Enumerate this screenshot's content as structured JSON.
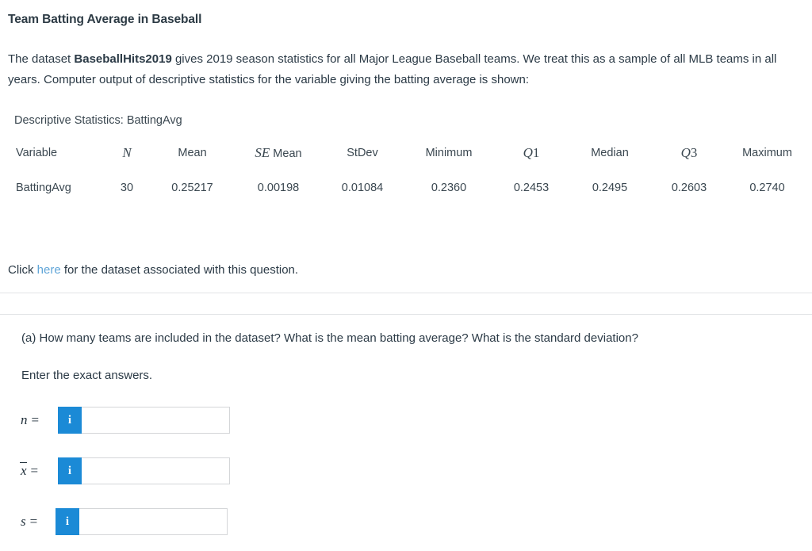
{
  "page": {
    "title": "Team Batting Average in Baseball",
    "intro_before_bold": "The dataset ",
    "intro_bold": "BaseballHits2019",
    "intro_after_bold": " gives 2019 season statistics for all Major League Baseball teams. We treat this as a sample of all MLB teams in all years. Computer output of descriptive statistics for the variable giving the batting average is shown:"
  },
  "stats_output": {
    "caption": "Descriptive Statistics: BattingAvg",
    "columns": [
      {
        "key": "variable",
        "label": "Variable",
        "style": "plain"
      },
      {
        "key": "n",
        "label": "N",
        "style": "math"
      },
      {
        "key": "mean",
        "label": "Mean",
        "style": "plain"
      },
      {
        "key": "se_mean",
        "label": "SE Mean",
        "style": "math-prefix"
      },
      {
        "key": "stdev",
        "label": "StDev",
        "style": "plain"
      },
      {
        "key": "minimum",
        "label": "Minimum",
        "style": "plain"
      },
      {
        "key": "q1",
        "label": "Q1",
        "style": "math"
      },
      {
        "key": "median",
        "label": "Median",
        "style": "plain"
      },
      {
        "key": "q3",
        "label": "Q3",
        "style": "math"
      },
      {
        "key": "maximum",
        "label": "Maximum",
        "style": "plain"
      }
    ],
    "header": {
      "variable": "Variable",
      "n": "N",
      "se_mean_italic": "SE",
      "se_mean_rest": " Mean",
      "mean": "Mean",
      "stdev": "StDev",
      "minimum": "Minimum",
      "q1_italic": "Q",
      "q1_num": "1",
      "median": "Median",
      "q3_italic": "Q",
      "q3_num": "3",
      "maximum": "Maximum"
    },
    "row": {
      "variable": "BattingAvg",
      "n": "30",
      "mean": "0.25217",
      "se_mean": "0.00198",
      "stdev": "0.01084",
      "minimum": "0.2360",
      "q1": "0.2453",
      "median": "0.2495",
      "q3": "0.2603",
      "maximum": "0.2740"
    }
  },
  "dataset_link": {
    "text_before": "Click ",
    "link_label": "here",
    "text_after": " for the dataset associated with this question.",
    "link_color": "#60a5d8"
  },
  "question": {
    "prompt": "(a) How many teams are included in the dataset? What is the mean batting average? What is the standard deviation?",
    "instruction": "Enter the exact answers."
  },
  "answers": {
    "accent_color": "#1b8ad6",
    "info_glyph": "i",
    "rows": [
      {
        "id": "n",
        "symbol": "n",
        "equals": "=",
        "value": "",
        "placeholder": ""
      },
      {
        "id": "xbar",
        "symbol": "x",
        "equals": "=",
        "value": "",
        "placeholder": ""
      },
      {
        "id": "s",
        "symbol": "s",
        "equals": "=",
        "value": "",
        "placeholder": ""
      }
    ]
  }
}
